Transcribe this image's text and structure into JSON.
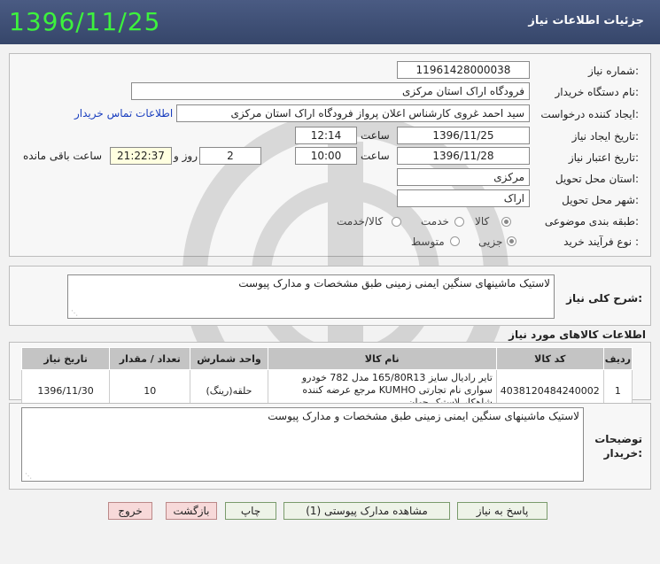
{
  "header": {
    "title": "جزئیات اطلاعات نیاز",
    "date_stamp": "1396/11/25"
  },
  "form": {
    "need_number": {
      "label": "شماره نیاز:",
      "value": "11961428000038"
    },
    "buyer_org": {
      "label": "نام دستگاه خریدار:",
      "value": "فرودگاه اراک استان مرکزی"
    },
    "requester": {
      "label": "ایجاد کننده درخواست:",
      "value": "سید احمد غروی کارشناس اعلان پرواز فرودگاه اراک استان مرکزی",
      "contact_link": "اطلاعات تماس خریدار"
    },
    "created": {
      "label": "تاریخ ایجاد نیاز:",
      "date": "1396/11/25",
      "time_label": "ساعت",
      "time": "12:14"
    },
    "validity": {
      "label": "تاریخ اعتبار نیاز:",
      "date": "1396/11/28",
      "time_label": "ساعت",
      "time": "10:00",
      "days": "2",
      "days_label": "روز و",
      "remaining": "21:22:37",
      "remaining_label": "ساعت باقی مانده"
    },
    "province": {
      "label": "استان محل تحویل:",
      "value": "مرکزی"
    },
    "city": {
      "label": "شهر محل تحویل:",
      "value": "اراک"
    },
    "category": {
      "label": "طبقه بندی موضوعی:",
      "options": [
        "کالا",
        "خدمت",
        "کالا/خدمت"
      ],
      "selected": "کالا"
    },
    "process": {
      "label": "نوع فرآیند خرید :",
      "options": [
        "جزیی",
        "متوسط"
      ],
      "selected": "جزیی"
    }
  },
  "summary": {
    "label": "شرح کلی نیاز:",
    "value": "لاستیک ماشینهای سنگین ایمنی زمینی طبق مشخصات و مدارک پیوست"
  },
  "items": {
    "title": "اطلاعات کالاهای مورد نیاز",
    "columns": [
      "ردیف",
      "کد کالا",
      "نام کالا",
      "واحد شمارش",
      "تعداد / مقدار",
      "تاریخ نیاز"
    ],
    "rows": [
      {
        "row": "1",
        "code": "4038120484240002",
        "name": "تایر رادیال سایز 165/80R13 مدل 782 خودرو سواری نام تجارتی KUMHO مرجع عرضه کننده شاهکار لاستیک جهان",
        "unit": "حلقه(رینگ)",
        "qty": "10",
        "date": "1396/11/30"
      }
    ]
  },
  "buyer_notes": {
    "label": "توضیحات خریدار:",
    "value": "لاستیک ماشینهای سنگین ایمنی زمینی طبق مشخصات و مدارک پیوست"
  },
  "buttons": {
    "reply": "پاسخ به نیاز",
    "attachments": "مشاهده مدارک پیوستی (1)",
    "print": "چاپ",
    "back": "بازگشت",
    "exit": "خروج"
  }
}
